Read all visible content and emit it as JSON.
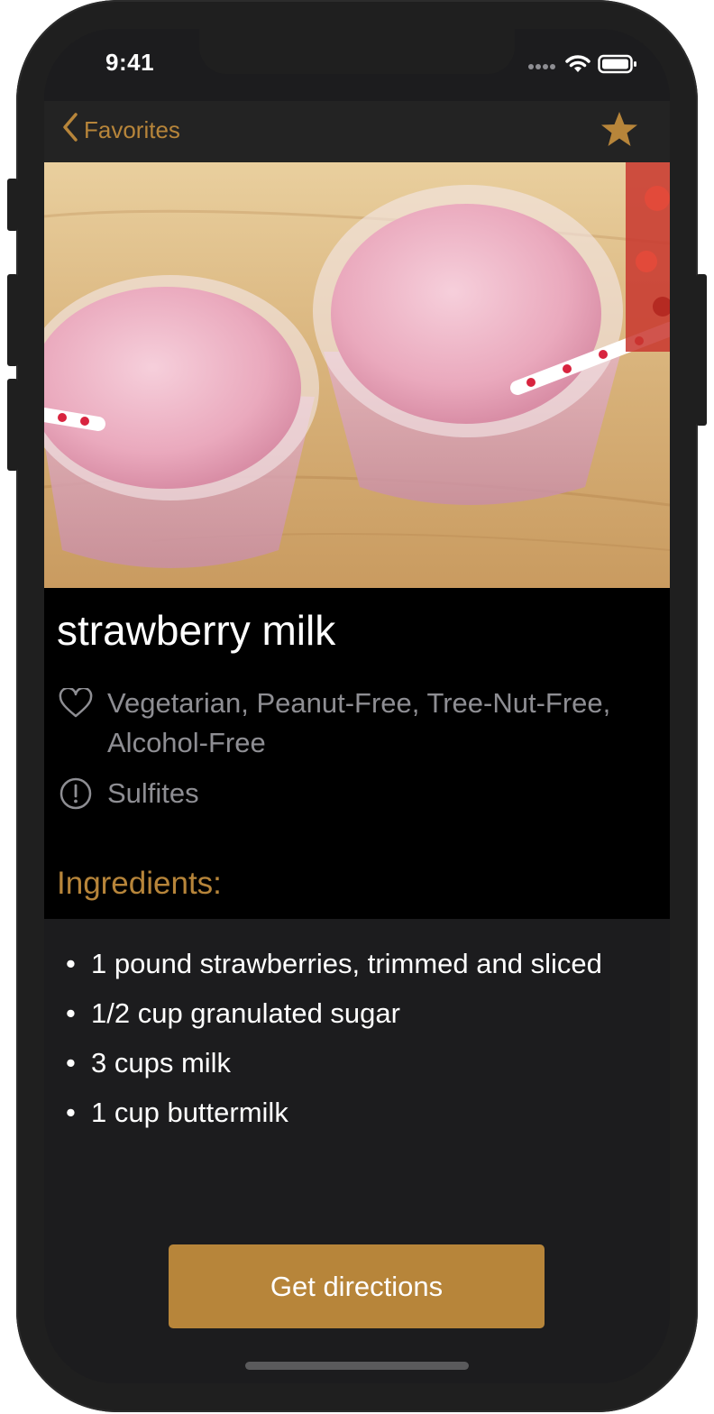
{
  "status_bar": {
    "time": "9:41"
  },
  "nav": {
    "back_label": "Favorites",
    "favorite_icon": "star-icon",
    "accent_color": "#b7853a"
  },
  "recipe": {
    "title": "strawberry milk",
    "diet_labels": "Vegetarian, Peanut-Free, Tree-Nut-Free, Alcohol-Free",
    "cautions": "Sulfites",
    "ingredients_heading": "Ingredients:",
    "ingredients": [
      "1 pound strawberries, trimmed and sliced",
      "1/2 cup granulated sugar",
      "3 cups milk",
      "1 cup buttermilk"
    ],
    "bullet": "•"
  },
  "actions": {
    "directions_label": "Get directions"
  },
  "icons": {
    "diet": "heart-icon",
    "caution": "exclamation-circle-icon",
    "back": "chevron-left-icon"
  }
}
